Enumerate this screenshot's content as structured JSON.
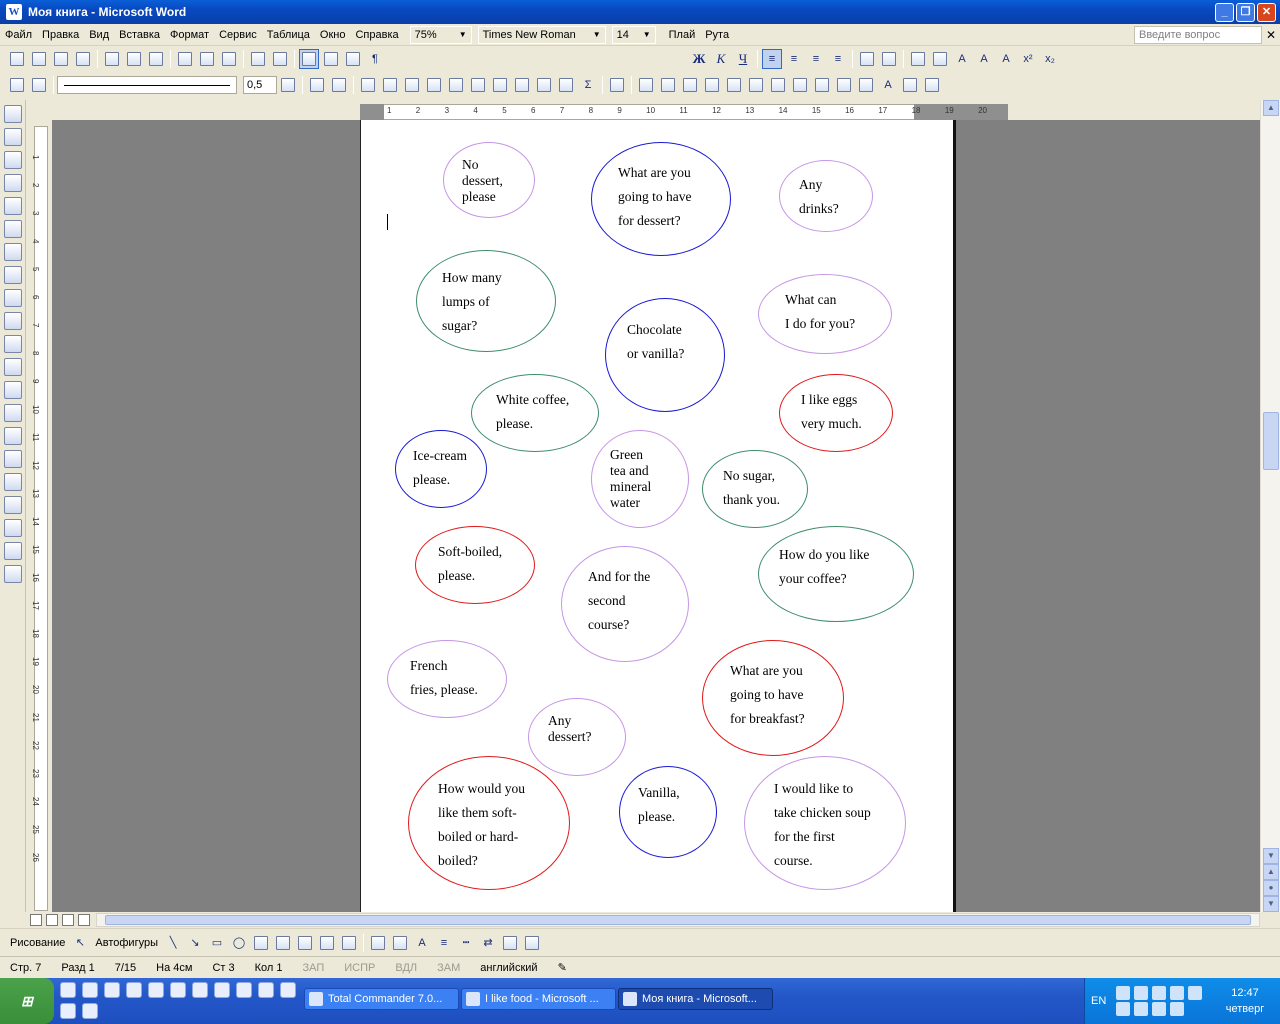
{
  "window": {
    "title": "Моя книга - Microsoft Word",
    "minimize": "_",
    "maximize": "❐",
    "close": "✕"
  },
  "menu": {
    "items": [
      "Файл",
      "Правка",
      "Вид",
      "Вставка",
      "Формат",
      "Сервис",
      "Таблица",
      "Окно",
      "Справка"
    ],
    "zoom": "75%",
    "font": "Times New Roman",
    "size": "14",
    "links": [
      "Плай",
      "Рута"
    ],
    "ask_placeholder": "Введите вопрос",
    "close_doc": "✕"
  },
  "format_toolbar": {
    "bold": "Ж",
    "italic": "К",
    "underline": "Ч"
  },
  "tables_toolbar": {
    "line_weight": "0,5"
  },
  "ruler": {
    "horizontal": [
      "1",
      "2",
      "3",
      "4",
      "5",
      "6",
      "7",
      "8",
      "9",
      "10",
      "11",
      "12",
      "13",
      "14",
      "15",
      "16",
      "17",
      "18",
      "19",
      "20"
    ],
    "vertical": [
      "1",
      "2",
      "3",
      "4",
      "5",
      "6",
      "7",
      "8",
      "9",
      "10",
      "11",
      "12",
      "13",
      "14",
      "15",
      "16",
      "17",
      "18",
      "19",
      "20",
      "21",
      "22",
      "23",
      "24",
      "25",
      "26"
    ]
  },
  "bubbles": [
    {
      "text": "No\ndessert,\nplease",
      "color": "violet",
      "tight": true
    },
    {
      "text": "What are you\ngoing to have\nfor dessert?",
      "color": "blue",
      "tight": false
    },
    {
      "text": "Any\ndrinks?",
      "color": "violet",
      "tight": false
    },
    {
      "text": "How many\nlumps of\nsugar?",
      "color": "green",
      "tight": false
    },
    {
      "text": "What can\nI do for you?",
      "color": "violet",
      "tight": false
    },
    {
      "text": "Chocolate\nor vanilla?",
      "color": "blue",
      "tight": false
    },
    {
      "text": "White coffee,\nplease.",
      "color": "green",
      "tight": false
    },
    {
      "text": "I like eggs\nvery much.",
      "color": "red",
      "tight": false
    },
    {
      "text": "Ice-cream\nplease.",
      "color": "blue",
      "tight": false
    },
    {
      "text": "Green\ntea and\nmineral\nwater",
      "color": "violet",
      "tight": true
    },
    {
      "text": "No sugar,\nthank you.",
      "color": "green",
      "tight": false
    },
    {
      "text": "Soft-boiled,\nplease.",
      "color": "red",
      "tight": false
    },
    {
      "text": "And for the\nsecond\ncourse?",
      "color": "violet",
      "tight": false
    },
    {
      "text": "How do you like\nyour coffee?",
      "color": "green",
      "tight": false
    },
    {
      "text": "French\nfries, please.",
      "color": "violet",
      "tight": false
    },
    {
      "text": "What are you\ngoing to have\nfor breakfast?",
      "color": "red",
      "tight": false
    },
    {
      "text": "Any\ndessert?",
      "color": "violet",
      "tight": true
    },
    {
      "text": "How would you\nlike them soft-\nboiled or hard-\nboiled?",
      "color": "red",
      "tight": false
    },
    {
      "text": "Vanilla,\nplease.",
      "color": "blue",
      "tight": false
    },
    {
      "text": "I would like to\ntake chicken soup\nfor the first\ncourse.",
      "color": "violet",
      "tight": false
    }
  ],
  "colors": {
    "blue": "#1a1ad4",
    "violet": "#c596e6",
    "green": "#3e8d6a",
    "red": "#e01a1a"
  },
  "drawbar": {
    "drawing": "Рисование",
    "autoshapes": "Автофигуры"
  },
  "status": {
    "page": "Стр. 7",
    "section": "Разд 1",
    "pages": "7/15",
    "at": "На 4см",
    "line": "Ст 3",
    "col": "Кол 1",
    "rec": "ЗАП",
    "trk": "ИСПР",
    "ext": "ВДЛ",
    "ovr": "ЗАМ",
    "language": "английский"
  },
  "taskbar": {
    "tasks": [
      "Total Commander 7.0...",
      "I like food - Microsoft ...",
      "Моя книга - Microsoft..."
    ],
    "lang": "EN",
    "time": "12:47",
    "day": "четверг"
  }
}
